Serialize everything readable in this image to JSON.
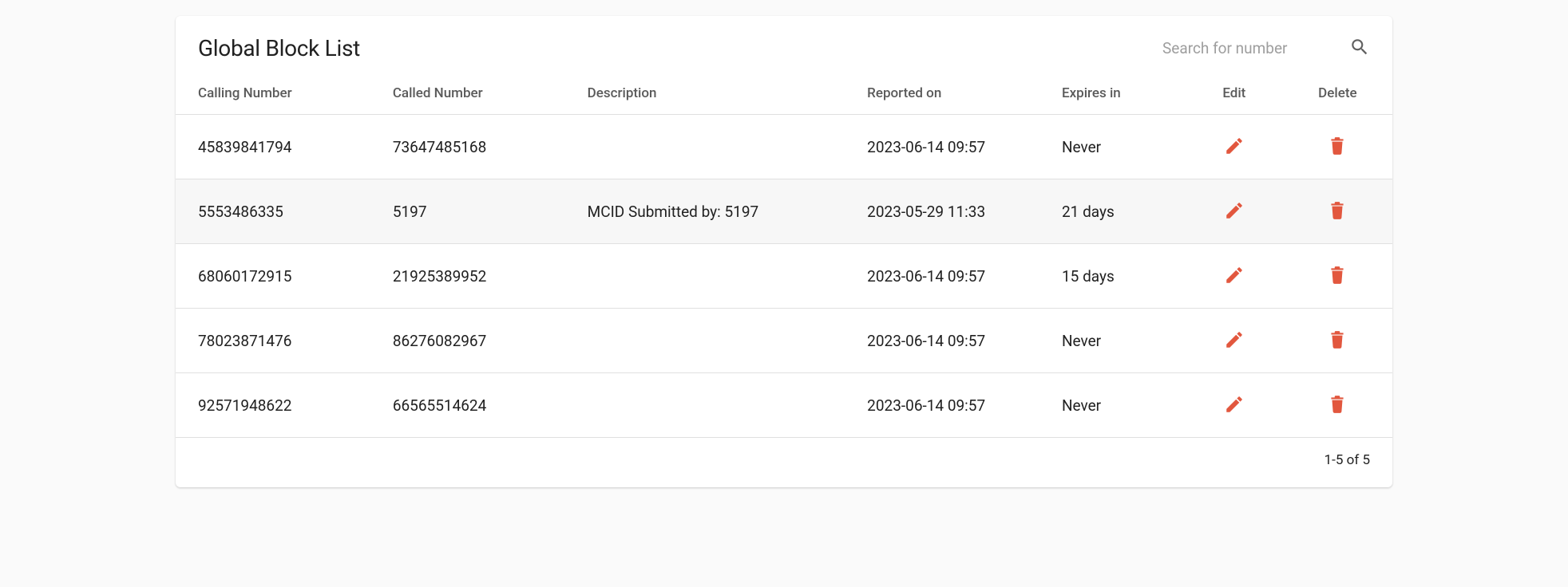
{
  "title": "Global Block List",
  "search": {
    "placeholder": "Search for number"
  },
  "columns": {
    "calling": "Calling Number",
    "called": "Called Number",
    "description": "Description",
    "reported": "Reported on",
    "expires": "Expires in",
    "edit": "Edit",
    "delete": "Delete"
  },
  "rows": [
    {
      "calling": "45839841794",
      "called": "73647485168",
      "description": "",
      "reported": "2023-06-14 09:57",
      "expires": "Never"
    },
    {
      "calling": "5553486335",
      "called": "5197",
      "description": "MCID Submitted by: 5197",
      "reported": "2023-05-29 11:33",
      "expires": "21 days"
    },
    {
      "calling": "68060172915",
      "called": "21925389952",
      "description": "",
      "reported": "2023-06-14 09:57",
      "expires": "15 days"
    },
    {
      "calling": "78023871476",
      "called": "86276082967",
      "description": "",
      "reported": "2023-06-14 09:57",
      "expires": "Never"
    },
    {
      "calling": "92571948622",
      "called": "66565514624",
      "description": "",
      "reported": "2023-06-14 09:57",
      "expires": "Never"
    }
  ],
  "pagination": "1-5 of 5"
}
